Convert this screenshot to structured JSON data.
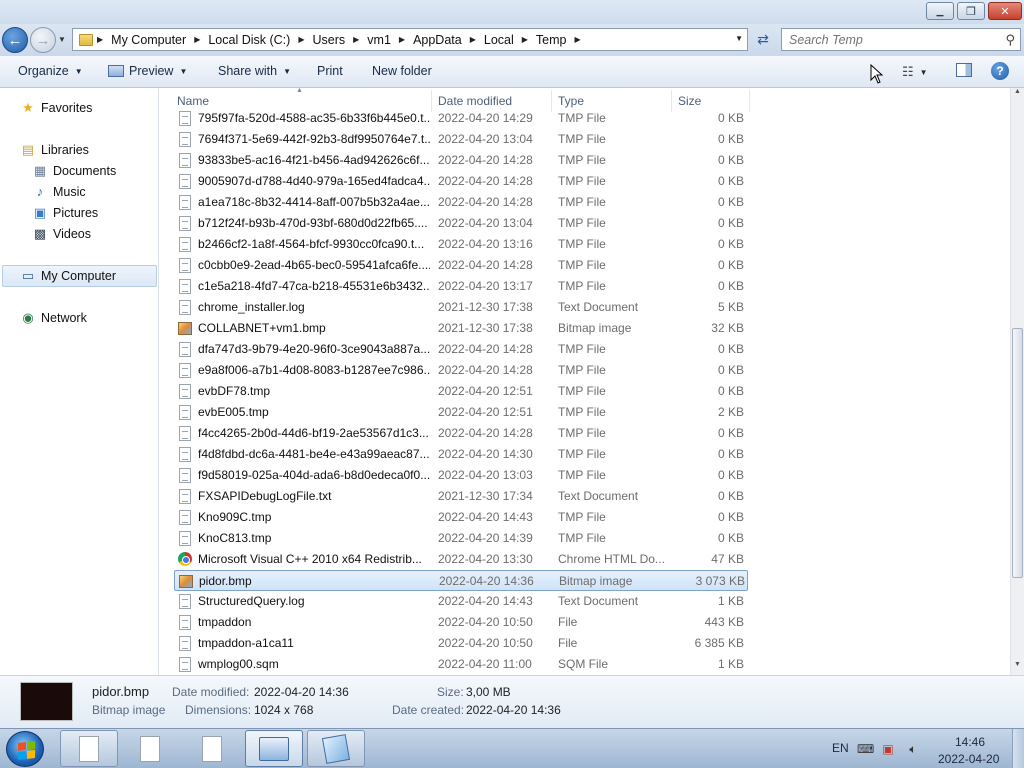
{
  "window": {
    "controls": {
      "minimize": "▁",
      "maximize": "❐",
      "close": "✕"
    }
  },
  "address": {
    "breadcrumbs": [
      "My Computer",
      "Local Disk (C:)",
      "Users",
      "vm1",
      "AppData",
      "Local",
      "Temp"
    ],
    "search_placeholder": "Search Temp"
  },
  "toolbar": {
    "organize": "Organize",
    "preview": "Preview",
    "share_with": "Share with",
    "print": "Print",
    "new_folder": "New folder"
  },
  "nav": {
    "favorites": "Favorites",
    "libraries": "Libraries",
    "documents": "Documents",
    "music": "Music",
    "pictures": "Pictures",
    "videos": "Videos",
    "my_computer": "My Computer",
    "network": "Network"
  },
  "columns": {
    "name": "Name",
    "date_modified": "Date modified",
    "type": "Type",
    "size": "Size"
  },
  "files": [
    {
      "name": "795f97fa-520d-4588-ac35-6b33f6b445e0.t...",
      "date": "2022-04-20 14:29",
      "type": "TMP File",
      "size": "0 KB",
      "icon": "doc"
    },
    {
      "name": "7694f371-5e69-442f-92b3-8df9950764e7.t...",
      "date": "2022-04-20 13:04",
      "type": "TMP File",
      "size": "0 KB",
      "icon": "doc"
    },
    {
      "name": "93833be5-ac16-4f21-b456-4ad942626c6f....",
      "date": "2022-04-20 14:28",
      "type": "TMP File",
      "size": "0 KB",
      "icon": "doc"
    },
    {
      "name": "9005907d-d788-4d40-979a-165ed4fadca4...",
      "date": "2022-04-20 14:28",
      "type": "TMP File",
      "size": "0 KB",
      "icon": "doc"
    },
    {
      "name": "a1ea718c-8b32-4414-8aff-007b5b32a4ae....",
      "date": "2022-04-20 14:28",
      "type": "TMP File",
      "size": "0 KB",
      "icon": "doc"
    },
    {
      "name": "b712f24f-b93b-470d-93bf-680d0d22fb65....",
      "date": "2022-04-20 13:04",
      "type": "TMP File",
      "size": "0 KB",
      "icon": "doc"
    },
    {
      "name": "b2466cf2-1a8f-4564-bfcf-9930cc0fca90.t...",
      "date": "2022-04-20 13:16",
      "type": "TMP File",
      "size": "0 KB",
      "icon": "doc"
    },
    {
      "name": "c0cbb0e9-2ead-4b65-bec0-59541afca6fe....",
      "date": "2022-04-20 14:28",
      "type": "TMP File",
      "size": "0 KB",
      "icon": "doc"
    },
    {
      "name": "c1e5a218-4fd7-47ca-b218-45531e6b3432....",
      "date": "2022-04-20 13:17",
      "type": "TMP File",
      "size": "0 KB",
      "icon": "doc"
    },
    {
      "name": "chrome_installer.log",
      "date": "2021-12-30 17:38",
      "type": "Text Document",
      "size": "5 KB",
      "icon": "doc"
    },
    {
      "name": "COLLABNET+vm1.bmp",
      "date": "2021-12-30 17:38",
      "type": "Bitmap image",
      "size": "32 KB",
      "icon": "bmp"
    },
    {
      "name": "dfa747d3-9b79-4e20-96f0-3ce9043a887a....",
      "date": "2022-04-20 14:28",
      "type": "TMP File",
      "size": "0 KB",
      "icon": "doc"
    },
    {
      "name": "e9a8f006-a7b1-4d08-8083-b1287ee7c986....",
      "date": "2022-04-20 14:28",
      "type": "TMP File",
      "size": "0 KB",
      "icon": "doc"
    },
    {
      "name": "evbDF78.tmp",
      "date": "2022-04-20 12:51",
      "type": "TMP File",
      "size": "0 KB",
      "icon": "doc"
    },
    {
      "name": "evbE005.tmp",
      "date": "2022-04-20 12:51",
      "type": "TMP File",
      "size": "2 KB",
      "icon": "doc"
    },
    {
      "name": "f4cc4265-2b0d-44d6-bf19-2ae53567d1c3....",
      "date": "2022-04-20 14:28",
      "type": "TMP File",
      "size": "0 KB",
      "icon": "doc"
    },
    {
      "name": "f4d8fdbd-dc6a-4481-be4e-e43a99aeac87....",
      "date": "2022-04-20 14:30",
      "type": "TMP File",
      "size": "0 KB",
      "icon": "doc"
    },
    {
      "name": "f9d58019-025a-404d-ada6-b8d0edeca0f0....",
      "date": "2022-04-20 13:03",
      "type": "TMP File",
      "size": "0 KB",
      "icon": "doc"
    },
    {
      "name": "FXSAPIDebugLogFile.txt",
      "date": "2021-12-30 17:34",
      "type": "Text Document",
      "size": "0 KB",
      "icon": "doc"
    },
    {
      "name": "Kno909C.tmp",
      "date": "2022-04-20 14:43",
      "type": "TMP File",
      "size": "0 KB",
      "icon": "doc"
    },
    {
      "name": "KnoC813.tmp",
      "date": "2022-04-20 14:39",
      "type": "TMP File",
      "size": "0 KB",
      "icon": "doc"
    },
    {
      "name": "Microsoft Visual C++ 2010  x64 Redistrib...",
      "date": "2022-04-20 13:30",
      "type": "Chrome HTML Do...",
      "size": "47 KB",
      "icon": "html"
    },
    {
      "name": "pidor.bmp",
      "date": "2022-04-20 14:36",
      "type": "Bitmap image",
      "size": "3 073 KB",
      "icon": "bmp",
      "selected": true
    },
    {
      "name": "StructuredQuery.log",
      "date": "2022-04-20 14:43",
      "type": "Text Document",
      "size": "1 KB",
      "icon": "doc"
    },
    {
      "name": "tmpaddon",
      "date": "2022-04-20 10:50",
      "type": "File",
      "size": "443 KB",
      "icon": "doc"
    },
    {
      "name": "tmpaddon-a1ca11",
      "date": "2022-04-20 10:50",
      "type": "File",
      "size": "6 385 KB",
      "icon": "doc"
    },
    {
      "name": "wmplog00.sqm",
      "date": "2022-04-20 11:00",
      "type": "SQM File",
      "size": "1 KB",
      "icon": "doc"
    }
  ],
  "details": {
    "filename": "pidor.bmp",
    "filetype": "Bitmap image",
    "date_modified_label": "Date modified:",
    "date_modified": "2022-04-20 14:36",
    "dimensions_label": "Dimensions:",
    "dimensions": "1024 x 768",
    "size_label": "Size:",
    "size": "3,00 MB",
    "date_created_label": "Date created:",
    "date_created": "2022-04-20 14:36"
  },
  "taskbar": {
    "language": "EN",
    "time": "14:46",
    "date": "2022-04-20"
  }
}
